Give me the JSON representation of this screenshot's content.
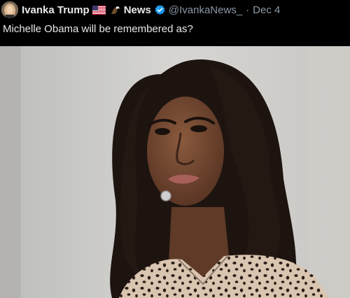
{
  "post": {
    "author": {
      "display_name": "Ivanka Trump",
      "flag_icon": "us-flag-icon",
      "badge_icon": "eagle-icon",
      "badge_label": "News",
      "verified_icon": "verified-badge-icon",
      "handle": "@IvankaNews_",
      "separator": "·",
      "date": "Dec 4"
    },
    "text": "Michelle Obama will be remembered as?",
    "media": {
      "type": "photo"
    }
  },
  "colors": {
    "background": "#000000",
    "text": "#e7e9ea",
    "secondary_text": "#8b98a5",
    "verified": "#1d9bf0"
  }
}
